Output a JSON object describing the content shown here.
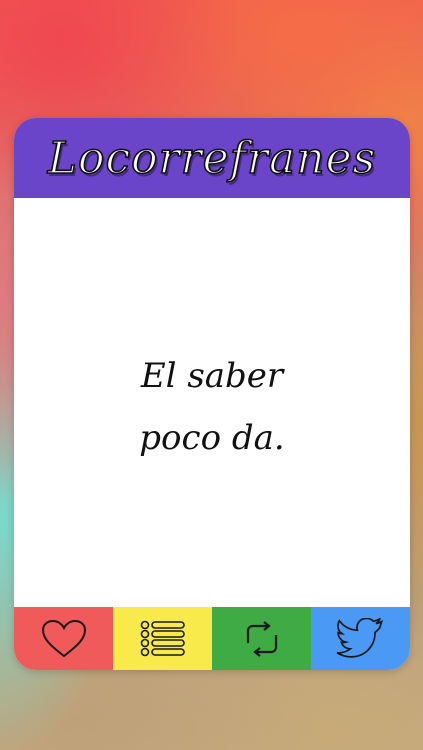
{
  "app": {
    "title": "Locorrefranes"
  },
  "card": {
    "proverb_line1": "El saber",
    "proverb_line2": "poco da.",
    "header_color": "#6b45c9"
  },
  "toolbar": {
    "buttons": [
      {
        "icon": "heart-icon",
        "color": "#f05a5a"
      },
      {
        "icon": "list-icon",
        "color": "#f7ea4a"
      },
      {
        "icon": "refresh-icon",
        "color": "#3eab45"
      },
      {
        "icon": "twitter-icon",
        "color": "#4a9af5"
      }
    ]
  }
}
